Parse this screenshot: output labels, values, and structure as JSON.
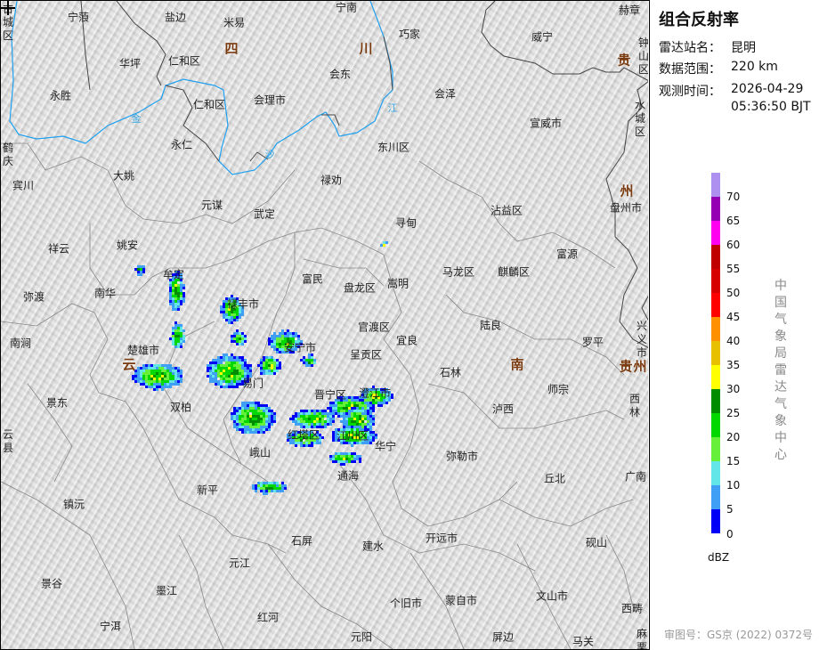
{
  "panel": {
    "title": "组合反射率",
    "station_label": "雷达站名：",
    "station_value": "昆明",
    "range_label": "数据范围：",
    "range_value": "220 km",
    "time_label": "观测时间：",
    "time_date": "2026-04-29",
    "time_clock": "05:36:50 BJT",
    "legend_ticks": [
      "70",
      "65",
      "60",
      "55",
      "50",
      "45",
      "40",
      "35",
      "30",
      "25",
      "20",
      "15",
      "10",
      "5",
      "0"
    ],
    "legend_colors": [
      "#ad90f0",
      "#9600b4",
      "#ff00f0",
      "#c00000",
      "#d60000",
      "#ff0000",
      "#ff9000",
      "#e7c000",
      "#ffff00",
      "#008c00",
      "#00d800",
      "#66f03a",
      "#63e6e8",
      "#3f9ff5",
      "#0000f6"
    ],
    "legend_unit": "dBZ",
    "agency": "中国气象局雷达气象中心",
    "approval": "审图号：GS京 (2022) 0372号"
  },
  "map": {
    "provinces": [
      "四",
      "川",
      "云",
      "南",
      "贵",
      "州",
      "贵",
      "州"
    ],
    "rivers": [
      "金",
      "沙",
      "江"
    ],
    "places": [
      "宁蒗",
      "盐边",
      "米易",
      "宁南",
      "巧家",
      "赫章",
      "威宁",
      "仁和区",
      "华坪",
      "会东",
      "永胜",
      "仁和区",
      "会理市",
      "会泽",
      "宣威市",
      "永仁",
      "东川区",
      "宾川",
      "大姚",
      "禄劝",
      "盘州市",
      "元谋",
      "武定",
      "沾益区",
      "寻甸",
      "祥云",
      "姚安",
      "富源",
      "马龙区",
      "麒麟区",
      "富民",
      "盘龙区",
      "嵩明",
      "弥渡",
      "南华",
      "牟定",
      "禄丰市",
      "官渡区",
      "陆良",
      "罗平",
      "宜良",
      "安宁市",
      "南涧",
      "楚雄市",
      "呈贡区",
      "石林",
      "师宗",
      "易门",
      "晋宁区",
      "澄江市",
      "泸西",
      "景东",
      "双柏",
      "红塔区",
      "江川区",
      "华宁",
      "峨山",
      "弥勒市",
      "丘北",
      "广南",
      "通海",
      "新平",
      "镇沅",
      "开远市",
      "石屏",
      "建水",
      "砚山",
      "元江",
      "景谷",
      "墨江",
      "个旧市",
      "蒙自市",
      "文山市",
      "西畴",
      "宁洱",
      "红河",
      "元阳",
      "屏边",
      "马关"
    ],
    "vertical_places": [
      "古城区",
      "钟山区",
      "水城区",
      "鹤庆",
      "兴义市",
      "西林",
      "云县",
      "麻栗坡"
    ]
  }
}
